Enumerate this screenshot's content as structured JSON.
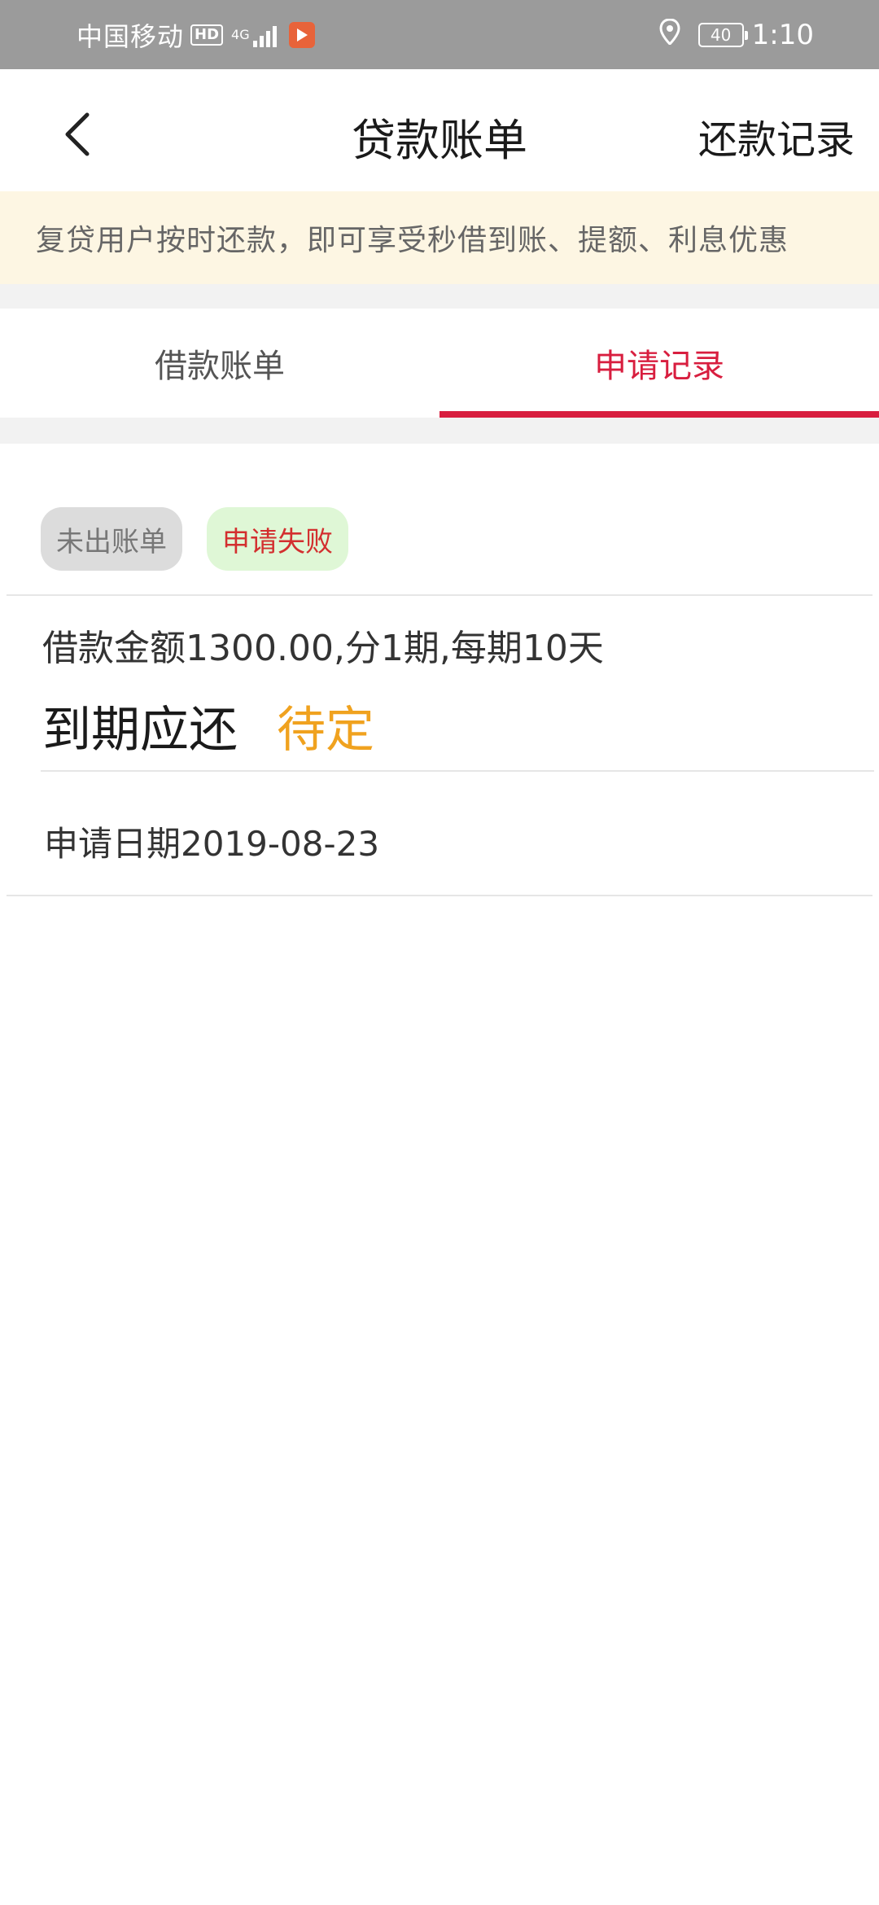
{
  "status_bar": {
    "carrier": "中国移动",
    "hd": "HD",
    "network": "4G",
    "battery": "40",
    "time": "1:10"
  },
  "header": {
    "title": "贷款账单",
    "right_link": "还款记录"
  },
  "notice": {
    "text": "复贷用户按时还款，即可享受秒借到账、提额、利息优惠"
  },
  "tabs": [
    {
      "label": "借款账单",
      "active": false
    },
    {
      "label": "申请记录",
      "active": true
    }
  ],
  "record": {
    "badge_bill": "未出账单",
    "badge_status": "申请失败",
    "loan_info": "借款金额1300.00,分1期,每期10天",
    "due_label": "到期应还",
    "due_value": "待定",
    "apply_date": "申请日期2019-08-23"
  },
  "colors": {
    "accent": "#d81e3f",
    "pending": "#f0a21f",
    "notice_bg": "#fdf6e3"
  }
}
